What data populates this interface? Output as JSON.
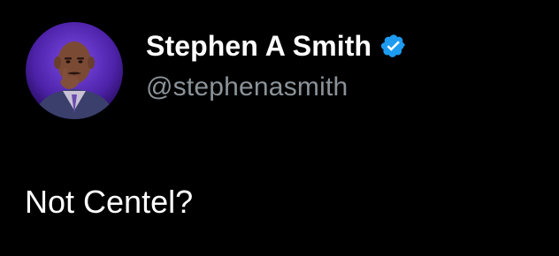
{
  "author": {
    "display_name": "Stephen A Smith",
    "handle": "@stephenasmith",
    "verified": true,
    "avatar_icon": "profile-photo"
  },
  "tweet": {
    "text": "Not Centel?"
  },
  "colors": {
    "background": "#000000",
    "name": "#ffffff",
    "handle": "#8b9399",
    "verified_badge": "#1d9bf0",
    "avatar_ring": "#6a3fd0"
  }
}
